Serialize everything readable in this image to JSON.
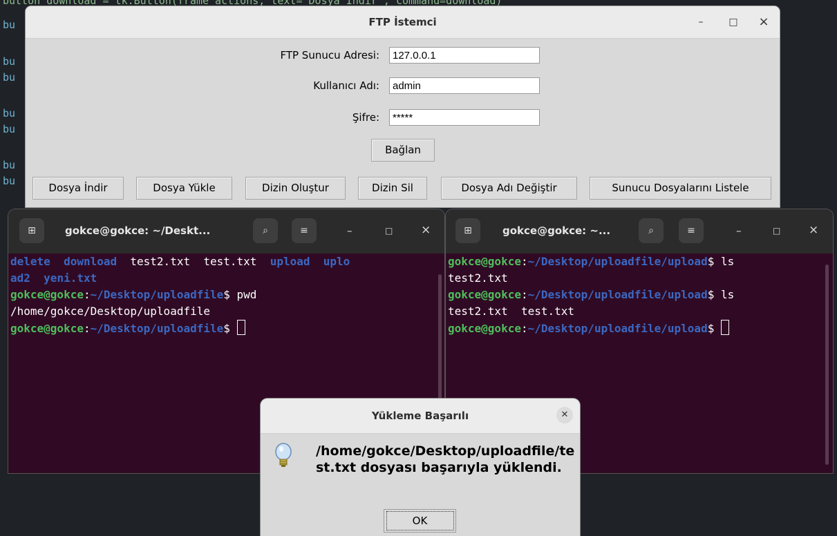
{
  "editor": {
    "topline": "button_download = tk.Button(frame_actions, text=\"Dosya İndir\", command=download)",
    "prefix": "bu"
  },
  "ftp": {
    "title": "FTP İstemci",
    "server_label": "FTP Sunucu Adresi:",
    "server_value": "127.0.0.1",
    "user_label": "Kullanıcı Adı:",
    "user_value": "admin",
    "pass_label": "Şifre:",
    "pass_value": "*****",
    "connect": "Bağlan",
    "actions": [
      "Dosya İndir",
      "Dosya Yükle",
      "Dizin Oluştur",
      "Dizin Sil",
      "Dosya Adı Değiştir",
      "Sunucu Dosyalarını Listele"
    ],
    "minimize": "–",
    "maximize": "□",
    "close": "×"
  },
  "term_left": {
    "title": "gokce@gokce: ~/Deskt...",
    "ls1": [
      "delete",
      "download",
      "test2.txt",
      "test.txt",
      "upload",
      "uplo"
    ],
    "ls2": [
      "ad2",
      "yeni.txt"
    ],
    "user": "gokce@gokce",
    "path": "~/Desktop/uploadfile",
    "cmd": "pwd",
    "out": "/home/gokce/Desktop/uploadfile"
  },
  "term_right": {
    "title": "gokce@gokce: ~...",
    "user": "gokce@gokce",
    "path": "~/Desktop/uploadfile/upload",
    "cmd": "ls",
    "out1": "test2.txt",
    "out2": "test2.txt  test.txt"
  },
  "dialog": {
    "title": "Yükleme Başarılı",
    "message": "/home/gokce/Desktop/uploadfile/test.txt dosyası başarıyla yüklendi.",
    "ok": "OK"
  }
}
